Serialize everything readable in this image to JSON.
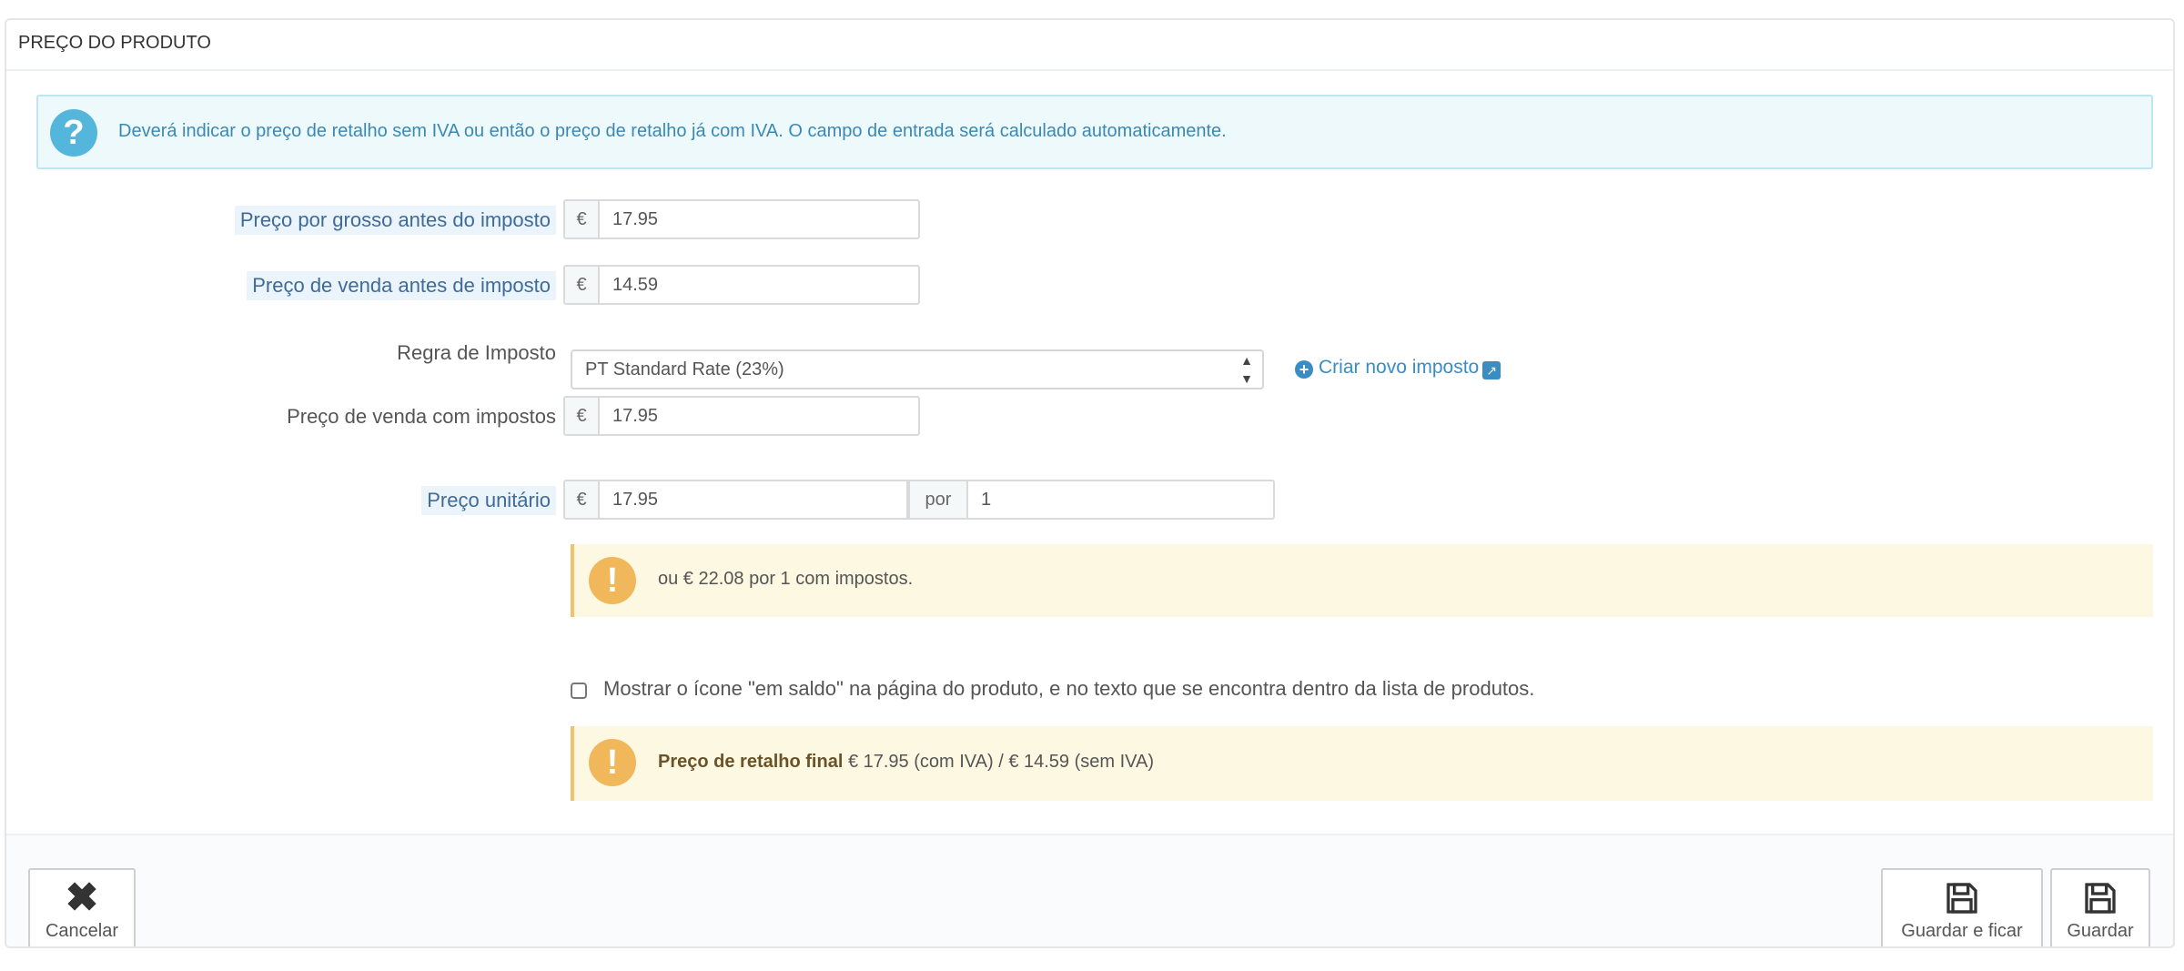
{
  "panel": {
    "title": "PREÇO DO PRODUTO",
    "info_text": "Deverá indicar o preço de retalho sem IVA ou então o preço de retalho já com IVA. O campo de entrada será calculado automaticamente."
  },
  "form": {
    "wholesale": {
      "label": "Preço por grosso antes do imposto",
      "currency": "€",
      "value": "17.95"
    },
    "retail_pre_tax": {
      "label": "Preço de venda antes de imposto",
      "currency": "€",
      "value": "14.59"
    },
    "tax_rule": {
      "label": "Regra de Imposto",
      "selected": "PT Standard Rate (23%)",
      "create_link": "Criar novo imposto"
    },
    "retail_with_tax": {
      "label": "Preço de venda com impostos",
      "currency": "€",
      "value": "17.95"
    },
    "unit_price": {
      "label": "Preço unitário",
      "currency": "€",
      "value": "17.95",
      "per_label": "por",
      "per_value": "1"
    },
    "unit_note": "ou € 22.08 por 1 com impostos.",
    "on_sale_checkbox": {
      "label": "Mostrar o ícone \"em saldo\" na página do produto, e no texto que se encontra dentro da lista de produtos.",
      "checked": false
    },
    "final_price": {
      "label": "Preço de retalho final",
      "text": "€ 17.95 (com IVA) / € 14.59 (sem IVA)"
    }
  },
  "footer": {
    "cancel": "Cancelar",
    "save_stay": "Guardar e ficar",
    "save": "Guardar"
  },
  "colors": {
    "info_bg": "#eef9fc",
    "info_text": "#3a89b5",
    "warning_bg": "#fcf8e1",
    "warning_icon": "#f0b85a",
    "link": "#3a8dc2"
  },
  "icons": {
    "info": "question-circle-icon",
    "warning": "exclamation-circle-icon",
    "cancel": "close-icon",
    "save": "floppy-disk-icon"
  }
}
